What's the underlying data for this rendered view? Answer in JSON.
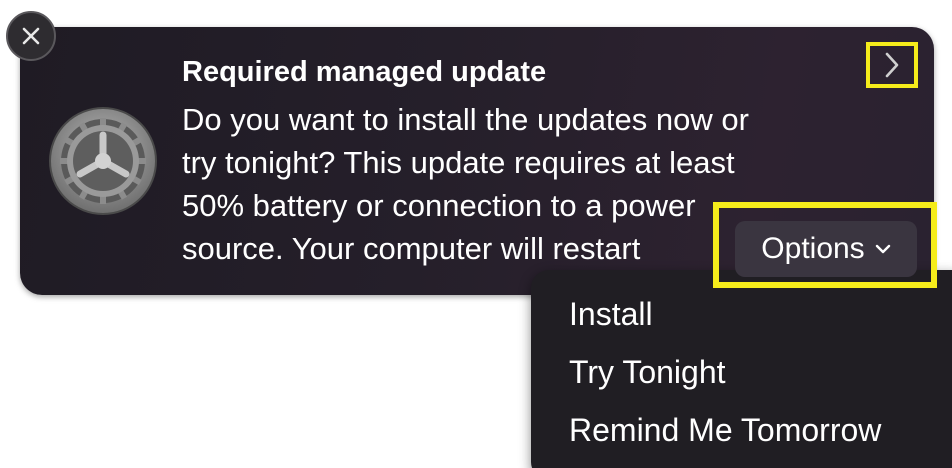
{
  "notification": {
    "title": "Required managed update",
    "body_lines": [
      "Do you want to install the updates now or",
      "try tonight? This update requires at least",
      "50% battery or connection to a power",
      "source. Your computer will restart"
    ],
    "close_icon": "close-icon",
    "app_icon": "system-settings-gear-icon",
    "expand_icon": "chevron-right-icon"
  },
  "options": {
    "label": "Options",
    "icon": "chevron-down-icon"
  },
  "menu": {
    "items": [
      {
        "label": "Install"
      },
      {
        "label": "Try Tonight"
      },
      {
        "label": "Remind Me Tomorrow"
      }
    ]
  },
  "colors": {
    "highlight": "#f5ec1b",
    "panel": "#241f28",
    "text": "#ffffff"
  }
}
